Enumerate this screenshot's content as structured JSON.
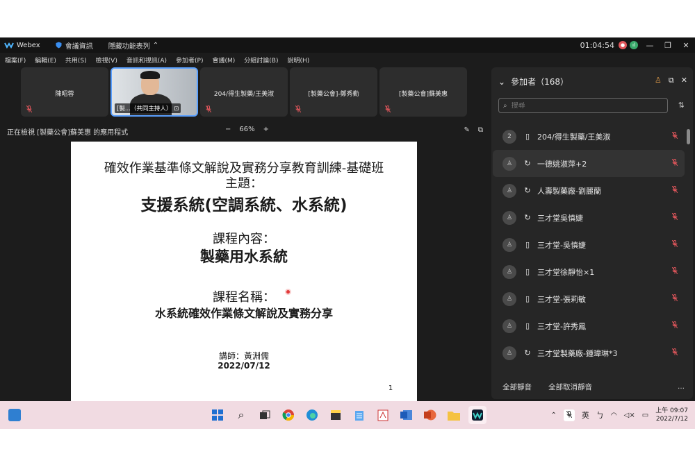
{
  "titlebar": {
    "app_name": "Webex",
    "meeting_info": "會議資訊",
    "hide_menu": "隱藏功能表列",
    "time": "01:04:54"
  },
  "menu": [
    "檔案(F)",
    "編輯(E)",
    "共用(S)",
    "檢視(V)",
    "音訊和視訊(A)",
    "參加者(P)",
    "會議(M)",
    "分組討論(B)",
    "說明(H)"
  ],
  "tiles": [
    {
      "name": "陳昭蓉",
      "video": false
    },
    {
      "name": "[製...（共同主持人）",
      "video": true
    },
    {
      "name": "204/得生製藥/王美淑",
      "video": false
    },
    {
      "name": "[製藥公會]-鄭秀勤",
      "video": false
    },
    {
      "name": "[製藥公會]蘇美惠",
      "video": false
    }
  ],
  "viewbar": {
    "label": "正在檢視 [製藥公會]蘇美惠 的應用程式",
    "zoom": "66%",
    "minus": "−",
    "plus": "+"
  },
  "slide": {
    "line1": "確效作業基準條文解說及實務分享教育訓練-基礎班",
    "line2": "主題：",
    "line3": "支援系統(空調系統、水系統)",
    "line4": "課程內容：",
    "line5": "製藥用水系統",
    "line6": "課程名稱：",
    "line7": "水系統確效作業條文解說及實務分享",
    "line8": "講師：黃淵儒",
    "line9": "2022/07/12",
    "page": "1"
  },
  "panel": {
    "title": "參加者（168）",
    "search_placeholder": "搜尋",
    "participants": [
      {
        "avatar": "2",
        "device": "phone",
        "name": "204/得生製藥/王美淑",
        "highlight": false
      },
      {
        "avatar": "",
        "device": "sync",
        "name": "一德姚淑萍+2",
        "highlight": true
      },
      {
        "avatar": "",
        "device": "sync",
        "name": "人壽製藥廠-劉麗蘭",
        "highlight": false
      },
      {
        "avatar": "",
        "device": "sync",
        "name": "三才堂吳慎婕",
        "highlight": false
      },
      {
        "avatar": "",
        "device": "phone",
        "name": "三才堂-吳慎婕",
        "highlight": false
      },
      {
        "avatar": "",
        "device": "phone",
        "name": "三才堂徐靜怡×1",
        "highlight": false
      },
      {
        "avatar": "",
        "device": "phone",
        "name": "三才堂-張莉敏",
        "highlight": false
      },
      {
        "avatar": "",
        "device": "phone",
        "name": "三才堂-許秀鳳",
        "highlight": false
      },
      {
        "avatar": "",
        "device": "sync",
        "name": "三才堂製藥廠-鍾瑋琳*3",
        "highlight": false
      }
    ],
    "mute_all": "全部靜音",
    "unmute_all": "全部取消靜音",
    "more": "…"
  },
  "taskbar": {
    "ime": "英",
    "time": "上午 09:07",
    "date": "2022/7/12"
  },
  "colors": {
    "accent": "#5aa0ff",
    "mic_muted": "#e0565b",
    "taskbar": "#f1dbe2"
  }
}
